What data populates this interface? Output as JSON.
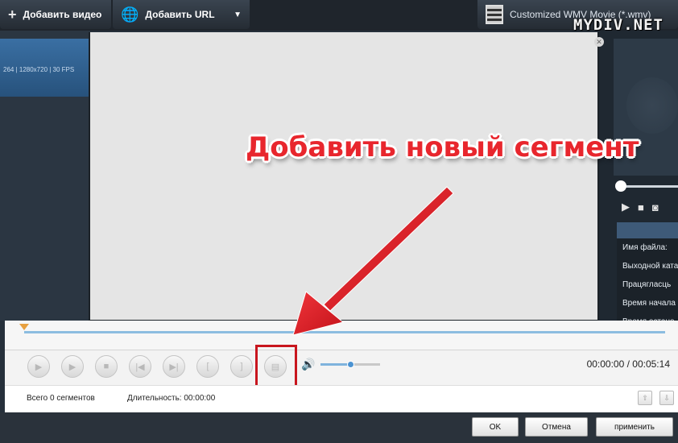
{
  "toolbar": {
    "add_video_label": "Добавить видео",
    "add_url_label": "Добавить URL",
    "profile_label": "Customized WMV Movie (*.wmv)"
  },
  "watermark": "MYDIV.NET",
  "background": {
    "video_info": "264 | 1280x720 | 30 FPS",
    "info_labels": [
      "Имя файла:",
      "Выходной ката",
      "Працягласць",
      "Время начала",
      "Время остано"
    ]
  },
  "annotation": {
    "text": "Добавить новый сегмент",
    "color": "#e8262d"
  },
  "player": {
    "time_display": "00:00:00 / 00:05:14",
    "volume_level": 0.5,
    "timeline_position": 0.0
  },
  "status": {
    "segment_count": "Всего 0 сегментов",
    "duration": "Длительность: 00:00:00"
  },
  "buttons": {
    "ok": "OK",
    "cancel": "Отмена",
    "apply": "применить"
  },
  "colors": {
    "highlight": "#c8161e",
    "accent": "#4c93d2"
  }
}
